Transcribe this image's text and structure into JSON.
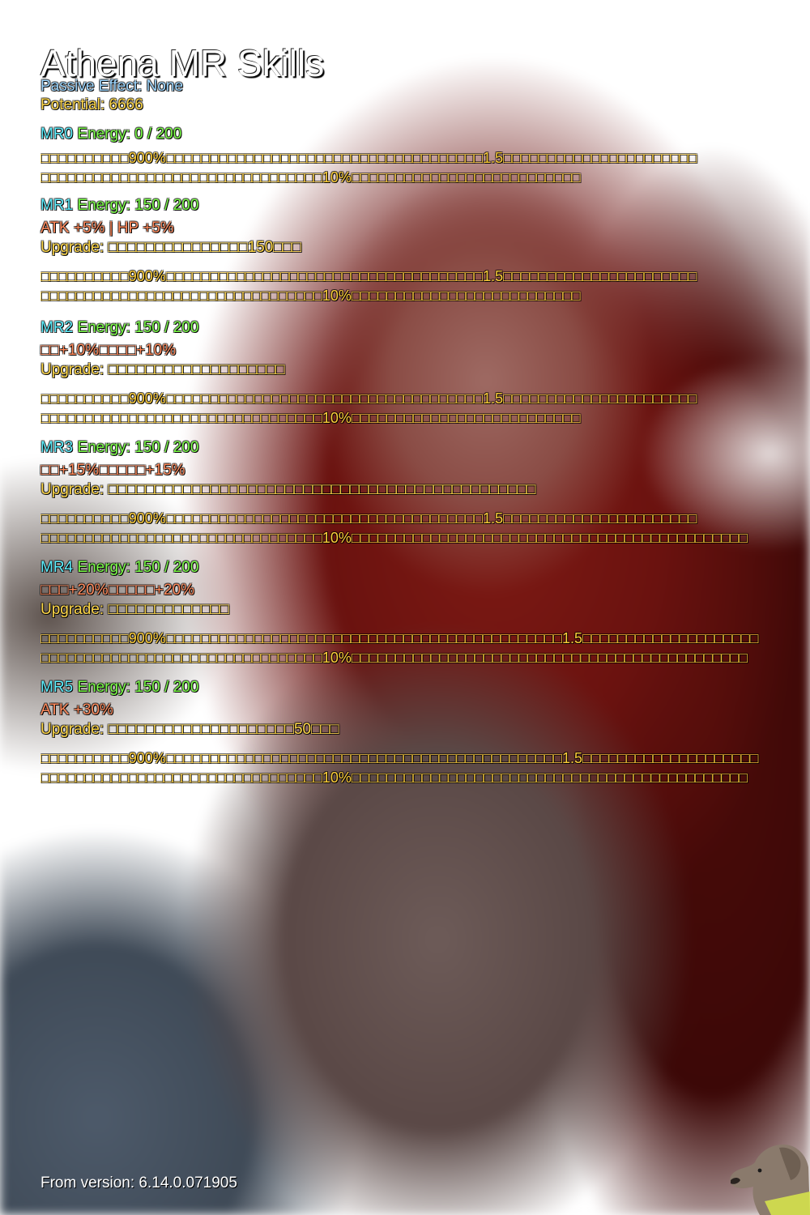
{
  "title": "Athena MR Skills",
  "passive": "Passive Effect: None",
  "potential": "Potential: 6666",
  "mr_levels": [
    {
      "name": "MR0",
      "energy": "Energy: 0 / 200",
      "stats": "",
      "upgrade": "",
      "desc_line1": "□□□□□□□□□□900%□□□□□□□□□□□□□□□□□□□□□□□□□□□□□□□□□□□□1.5□□□□□□□□□□□□□□□□□□□□□□",
      "desc_line2": "□□□□□□□□□□□□□□□□□□□□□□□□□□□□□□□□10%□□□□□□□□□□□□□□□□□□□□□□□□□□"
    },
    {
      "name": "MR1",
      "energy": "Energy: 150 / 200",
      "stats": "ATK +5% | HP +5%",
      "upgrade": "Upgrade: □□□□□□□□□□□□□□□150□□□",
      "desc_line1": "□□□□□□□□□□900%□□□□□□□□□□□□□□□□□□□□□□□□□□□□□□□□□□□□1.5□□□□□□□□□□□□□□□□□□□□□□",
      "desc_line2": "□□□□□□□□□□□□□□□□□□□□□□□□□□□□□□□□10%□□□□□□□□□□□□□□□□□□□□□□□□□□"
    },
    {
      "name": "MR2",
      "energy": "Energy: 150 / 200",
      "stats": "□□+10%□□□□+10%",
      "upgrade": "Upgrade: □□□□□□□□□□□□□□□□□□□",
      "desc_line1": "□□□□□□□□□□900%□□□□□□□□□□□□□□□□□□□□□□□□□□□□□□□□□□□□1.5□□□□□□□□□□□□□□□□□□□□□□",
      "desc_line2": "□□□□□□□□□□□□□□□□□□□□□□□□□□□□□□□□10%□□□□□□□□□□□□□□□□□□□□□□□□□□"
    },
    {
      "name": "MR3",
      "energy": "Energy: 150 / 200",
      "stats": "□□+15%□□□□□+15%",
      "upgrade": "Upgrade: □□□□□□□□□□□□□□□□□□□□□□□□□□□□□□□□□□□□□□□□□□□□□□",
      "desc_line1": "□□□□□□□□□□900%□□□□□□□□□□□□□□□□□□□□□□□□□□□□□□□□□□□□1.5□□□□□□□□□□□□□□□□□□□□□□",
      "desc_line2": "□□□□□□□□□□□□□□□□□□□□□□□□□□□□□□□□10%□□□□□□□□□□□□□□□□□□□□□□□□□□□□□□□□□□□□□□□□□□□□□"
    },
    {
      "name": "MR4",
      "energy": "Energy: 150 / 200",
      "stats": "□□□+20%□□□□□+20%",
      "upgrade": "Upgrade: □□□□□□□□□□□□□",
      "desc_line1": "□□□□□□□□□□900%□□□□□□□□□□□□□□□□□□□□□□□□□□□□□□□□□□□□□□□□□□□□□1.5□□□□□□□□□□□□□□□□□□□□",
      "desc_line2": "□□□□□□□□□□□□□□□□□□□□□□□□□□□□□□□□10%□□□□□□□□□□□□□□□□□□□□□□□□□□□□□□□□□□□□□□□□□□□□□"
    },
    {
      "name": "MR5",
      "energy": "Energy: 150 / 200",
      "stats": "ATK +30%",
      "upgrade": "Upgrade: □□□□□□□□□□□□□□□□□□□□50□□□",
      "desc_line1": "□□□□□□□□□□900%□□□□□□□□□□□□□□□□□□□□□□□□□□□□□□□□□□□□□□□□□□□□□1.5□□□□□□□□□□□□□□□□□□□□",
      "desc_line2": "□□□□□□□□□□□□□□□□□□□□□□□□□□□□□□□□10%□□□□□□□□□□□□□□□□□□□□□□□□□□□□□□□□□□□□□□□□□□□□□"
    }
  ],
  "footer": "From version: 6.14.0.071905",
  "colors": {
    "title": "#ffffff",
    "passive": "#9fd7ff",
    "potential": "#ffd84a",
    "mr_name": "#5ff0ff",
    "energy": "#7dff4a",
    "stats": "#ff8a5c",
    "upgrade": "#ffd84a",
    "description": "#ffcf3a"
  },
  "icons": [
    "dog-logo-icon"
  ]
}
